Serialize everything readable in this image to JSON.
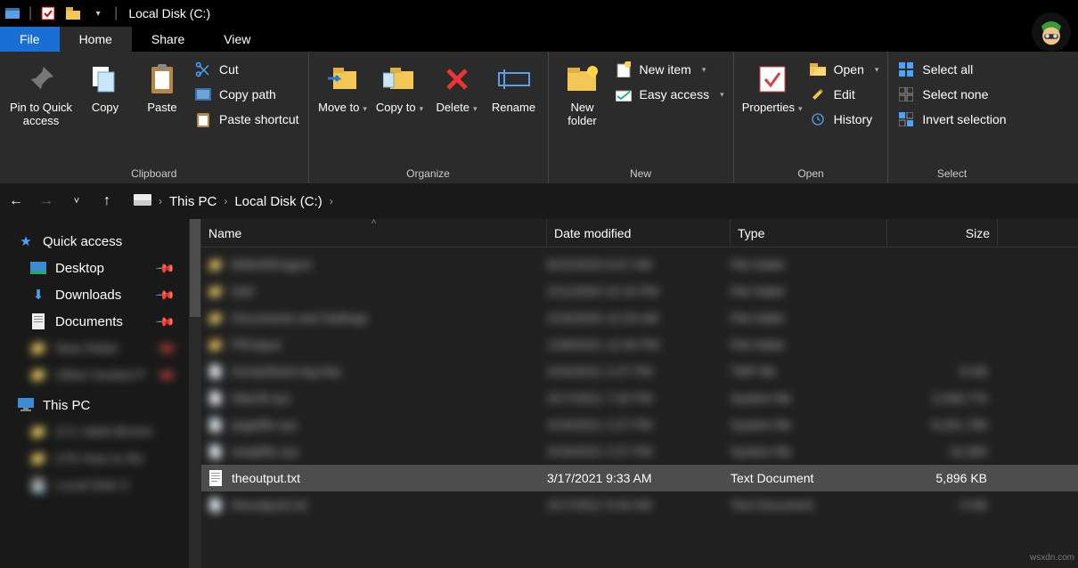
{
  "window_title": "Local Disk (C:)",
  "tabs": {
    "file": "File",
    "home": "Home",
    "share": "Share",
    "view": "View"
  },
  "ribbon": {
    "clipboard": {
      "label": "Clipboard",
      "pin": "Pin to Quick access",
      "copy": "Copy",
      "paste": "Paste",
      "cut": "Cut",
      "copy_path": "Copy path",
      "paste_shortcut": "Paste shortcut"
    },
    "organize": {
      "label": "Organize",
      "move_to": "Move to",
      "copy_to": "Copy to",
      "delete": "Delete",
      "rename": "Rename"
    },
    "new": {
      "label": "New",
      "new_folder": "New folder",
      "new_item": "New item",
      "easy_access": "Easy access"
    },
    "open": {
      "label": "Open",
      "properties": "Properties",
      "open": "Open",
      "edit": "Edit",
      "history": "History"
    },
    "select": {
      "label": "Select",
      "select_all": "Select all",
      "select_none": "Select none",
      "invert": "Invert selection"
    }
  },
  "breadcrumb": {
    "pc": "This PC",
    "drive": "Local Disk (C:)"
  },
  "sidebar": {
    "quick_access": "Quick access",
    "desktop": "Desktop",
    "downloads": "Downloads",
    "documents": "Documents",
    "this_pc": "This PC"
  },
  "columns": {
    "name": "Name",
    "date": "Date modified",
    "type": "Type",
    "size": "Size"
  },
  "file": {
    "name": "theoutput.txt",
    "date": "3/17/2021 9:33 AM",
    "type": "Text Document",
    "size": "5,896 KB"
  },
  "watermark": "wsxdn.com"
}
